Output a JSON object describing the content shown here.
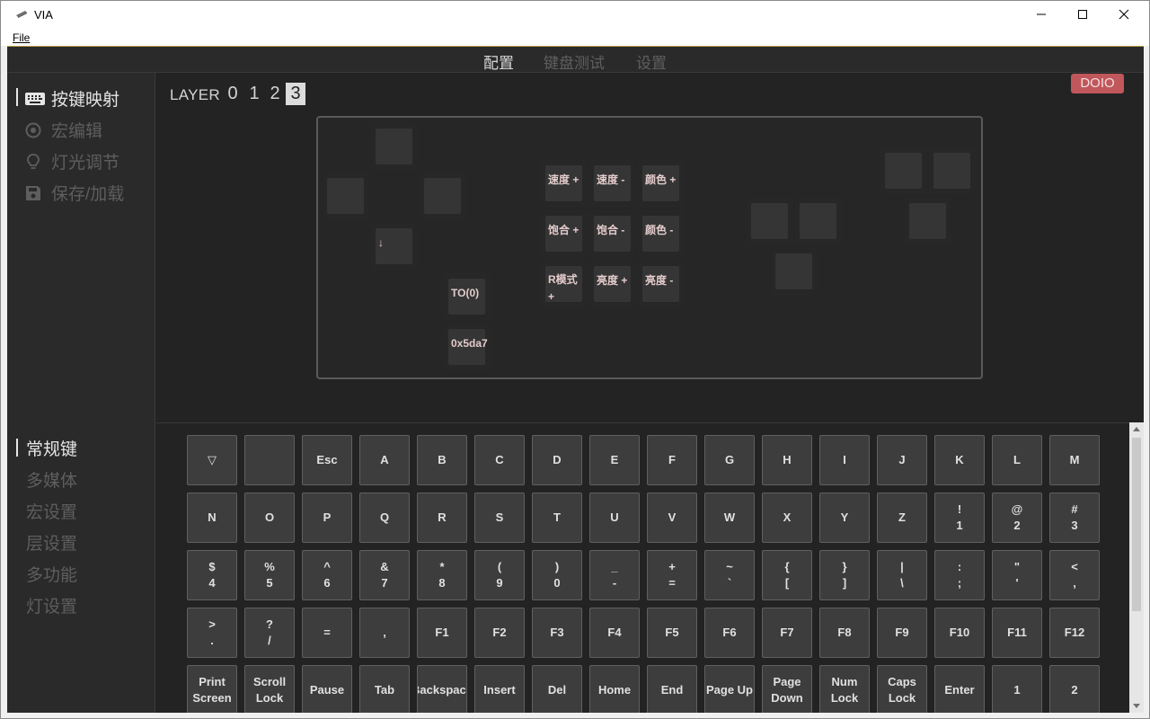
{
  "window": {
    "title": "VIA",
    "menu": [
      "File"
    ]
  },
  "topnav": [
    {
      "label": "配置",
      "active": true
    },
    {
      "label": "键盘测试",
      "active": false
    },
    {
      "label": "设置",
      "active": false
    }
  ],
  "sidebar_top": [
    {
      "label": "按键映射",
      "icon": "keyboard-icon",
      "active": true
    },
    {
      "label": "宏编辑",
      "icon": "record-icon",
      "active": false
    },
    {
      "label": "灯光调节",
      "icon": "lightbulb-icon",
      "active": false
    },
    {
      "label": "保存/加载",
      "icon": "save-icon",
      "active": false
    }
  ],
  "layers": {
    "label": "LAYER",
    "items": [
      "0",
      "1",
      "2",
      "3"
    ],
    "selected": "3"
  },
  "brand_badge": "DOIO",
  "keymap_keys": [
    "↓",
    "TO(0)",
    "0x5da7",
    "速度 +",
    "速度 -",
    "颜色 +",
    "饱合 +",
    "饱合 -",
    "颜色 -",
    "R模式 +",
    "亮度 +",
    "亮度 -"
  ],
  "sidebar_bottom": [
    {
      "label": "常规键",
      "active": true
    },
    {
      "label": "多媒体",
      "active": false
    },
    {
      "label": "宏设置",
      "active": false
    },
    {
      "label": "层设置",
      "active": false
    },
    {
      "label": "多功能",
      "active": false
    },
    {
      "label": "灯设置",
      "active": false
    }
  ],
  "key_palette": [
    [
      "▽",
      "",
      "Esc",
      "A",
      "B",
      "C",
      "D",
      "E",
      "F",
      "G",
      "H",
      "I",
      "J",
      "K",
      "L",
      "M"
    ],
    [
      "N",
      "O",
      "P",
      "Q",
      "R",
      "S",
      "T",
      "U",
      "V",
      "W",
      "X",
      "Y",
      "Z",
      "!\n1",
      "@\n2",
      "#\n3"
    ],
    [
      "$\n4",
      "%\n5",
      "^\n6",
      "&\n7",
      "*\n8",
      "(\n9",
      ")\n0",
      "_\n-",
      "+\n=",
      "~\n`",
      "{\n[",
      "}\n]",
      "|\n\\",
      ":\n;",
      "\"\n'",
      "<\n,"
    ],
    [
      ">\n.",
      "?\n/",
      "=",
      ",",
      "F1",
      "F2",
      "F3",
      "F4",
      "F5",
      "F6",
      "F7",
      "F8",
      "F9",
      "F10",
      "F11",
      "F12"
    ],
    [
      "Print\nScreen",
      "Scroll\nLock",
      "Pause",
      "Tab",
      "Backspace",
      "Insert",
      "Del",
      "Home",
      "End",
      "Page Up",
      "Page\nDown",
      "Num\nLock",
      "Caps\nLock",
      "Enter",
      "1",
      "2"
    ]
  ],
  "colors": {
    "accent_badge": "#c0575b",
    "background": "#232323",
    "panel": "#2a2a2a",
    "key_label": "#e4cccc"
  }
}
